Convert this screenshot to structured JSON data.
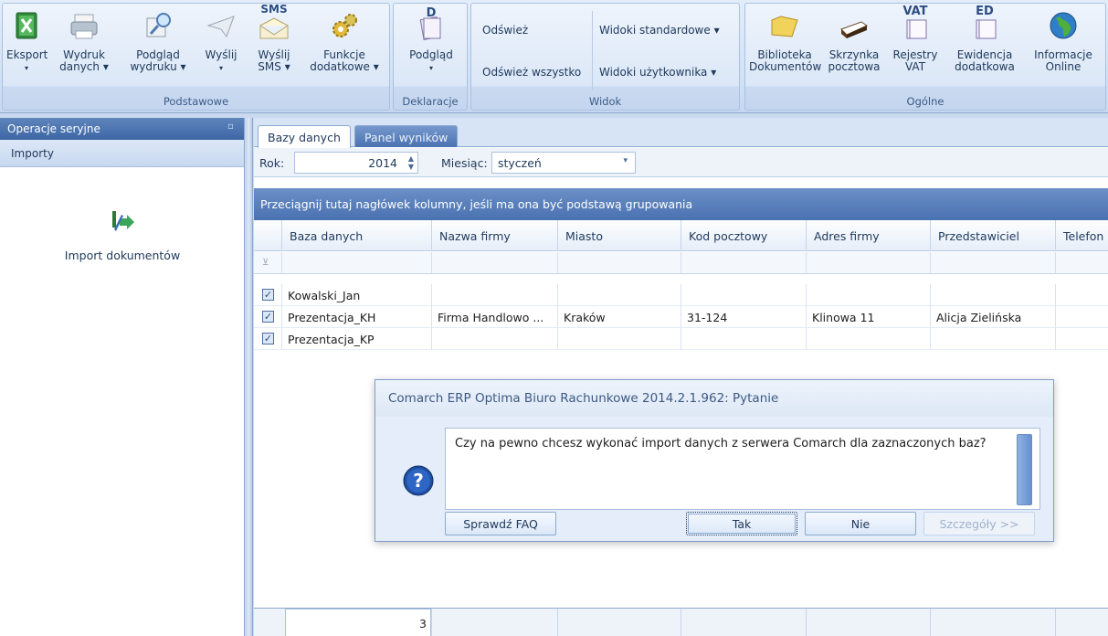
{
  "ribbon": {
    "groups": {
      "podstawowe": "Podstawowe",
      "deklaracje": "Deklaracje",
      "widok": "Widok",
      "ogolne": "Ogólne"
    },
    "buttons": {
      "eksport": "Eksport",
      "wydruk_1": "Wydruk",
      "wydruk_2": "danych",
      "podglad_wydruku_1": "Podgląd",
      "podglad_wydruku_2": "wydruku",
      "wyslij": "Wyślij",
      "wyslij_sms_1": "Wyślij",
      "wyslij_sms_2": "SMS",
      "funkcje_1": "Funkcje",
      "funkcje_2": "dodatkowe",
      "podglad": "Podgląd",
      "odswiez": "Odśwież",
      "odswiez_wszystko": "Odśwież wszystko",
      "widoki_standardowe": "Widoki standardowe",
      "widoki_uzytkownika": "Widoki użytkownika",
      "biblioteka_1": "Biblioteka",
      "biblioteka_2": "Dokumentów",
      "skrzynka_1": "Skrzynka",
      "skrzynka_2": "pocztowa",
      "rejestry_1": "Rejestry",
      "rejestry_2": "VAT",
      "ewidencja_1": "Ewidencja",
      "ewidencja_2": "dodatkowa",
      "informacje_1": "Informacje",
      "informacje_2": "Online"
    },
    "icon_text": {
      "sms": "SMS",
      "d": "D",
      "vat": "VAT",
      "ed": "ED"
    }
  },
  "left_panel": {
    "header": "Operacje seryjne",
    "section": "Importy",
    "item_label": "Import dokumentów"
  },
  "tabs": [
    {
      "label": "Bazy danych",
      "active": true
    },
    {
      "label": "Panel wyników",
      "active": false
    }
  ],
  "filter": {
    "year_label": "Rok:",
    "year_value": "2014",
    "month_label": "Miesiąc:",
    "month_value": "styczeń"
  },
  "grid": {
    "group_hint": "Przeciągnij tutaj nagłówek kolumny, jeśli ma ona być podstawą grupowania",
    "columns": [
      "Baza danych",
      "Nazwa firmy",
      "Miasto",
      "Kod pocztowy",
      "Adres firmy",
      "Przedstawiciel",
      "Telefon"
    ],
    "rows": [
      {
        "checked": true,
        "baza": "Kowalski_Jan",
        "nazwa": "",
        "miasto": "",
        "kod": "",
        "adres": "",
        "przedstawiciel": "",
        "telefon": ""
      },
      {
        "checked": true,
        "baza": "Prezentacja_KH",
        "nazwa": "Firma Handlowo ...",
        "miasto": "Kraków",
        "kod": "31-124",
        "adres": "Klinowa 11",
        "przedstawiciel": "Alicja Zielińska",
        "telefon": ""
      },
      {
        "checked": true,
        "baza": "Prezentacja_KP",
        "nazwa": "",
        "miasto": "",
        "kod": "",
        "adres": "",
        "przedstawiciel": "",
        "telefon": ""
      }
    ],
    "footer_count": "3"
  },
  "dialog": {
    "title": "Comarch ERP Optima Biuro Rachunkowe 2014.2.1.962: Pytanie",
    "message": "Czy na pewno chcesz wykonać import danych z serwera Comarch dla zaznaczonych baz?",
    "buttons": {
      "faq": "Sprawdź FAQ",
      "tak": "Tak",
      "nie": "Nie",
      "szczegoly": "Szczegóły >>"
    }
  },
  "colors": {
    "accent": "#4a72b1",
    "ribbon_bg": "#dbe7f7"
  }
}
